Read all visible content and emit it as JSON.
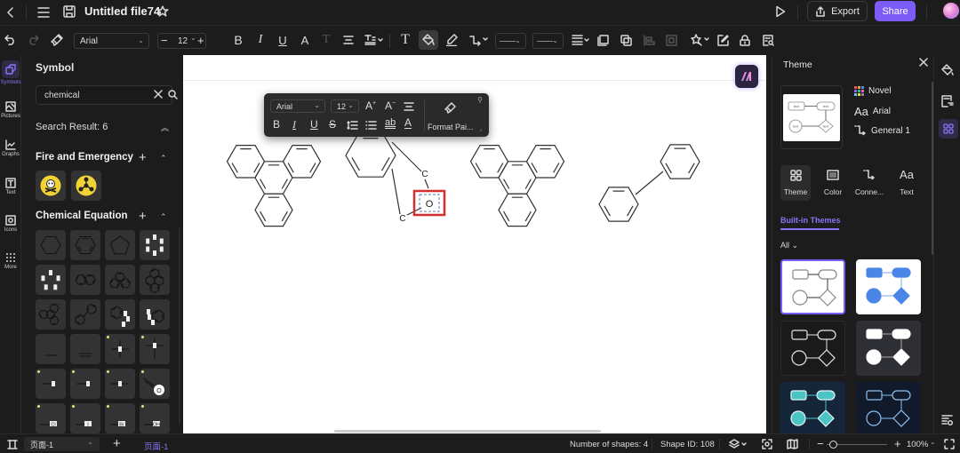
{
  "app": {
    "file_title": "Untitled file74",
    "export_label": "Export",
    "share_label": "Share"
  },
  "toolbar": {
    "font_family": "Arial",
    "font_size": "12"
  },
  "rail": {
    "items": [
      {
        "label": "Symbols",
        "icon": "symbols-icon",
        "active": true
      },
      {
        "label": "Pictures",
        "icon": "pictures-icon"
      },
      {
        "label": "Graphs",
        "icon": "graphs-icon"
      },
      {
        "label": "Text",
        "icon": "text-icon"
      },
      {
        "label": "Icons",
        "icon": "icons-icon"
      },
      {
        "label": "More",
        "icon": "more-icon"
      }
    ]
  },
  "symbol_panel": {
    "title": "Symbol",
    "search_value": "chemical",
    "search_result": "Search Result: 6",
    "categories": [
      {
        "name": "Fire and Emergency",
        "items": [
          "toxic-skull-symbol",
          "radiation-hazard-symbol"
        ]
      },
      {
        "name": "Chemical Equation",
        "items": [
          "cyclohexane",
          "benzene",
          "cyclopentane",
          "hexagon-atoms",
          "pentagon-atoms",
          "naphthalene",
          "phenanthrene",
          "pyrene",
          "triphenylene",
          "biphenyl",
          "indane",
          "indane-reversed",
          "single-bond",
          "double-bond",
          "carbon-cross",
          "carbon-cross-2",
          "bond-h",
          "bond-f",
          "bond-o",
          "bond-o-circle",
          "bond-cl",
          "bond-i",
          "bond-br",
          "bond-oh"
        ]
      }
    ],
    "atom_labels": {
      "cl": "Cl",
      "i": "I",
      "br": "Br",
      "oh": "OH",
      "o": "O"
    }
  },
  "format_toolbar": {
    "font_family": "Arial",
    "font_size": "12",
    "format_painter_label": "Format Pai..."
  },
  "canvas": {
    "shapes": [
      {
        "name": "triphenylene-1"
      },
      {
        "name": "indane-with-oxygen",
        "atoms": [
          "C",
          "C",
          "O"
        ]
      },
      {
        "name": "triphenylene-2"
      },
      {
        "name": "biphenyl"
      }
    ],
    "selected_atom": "O"
  },
  "theme_panel": {
    "title": "Theme",
    "preview_node_label": "text",
    "properties": [
      {
        "icon": "palette-icon",
        "label": "Novel"
      },
      {
        "icon": "font-icon",
        "label": "Arial"
      },
      {
        "icon": "connector-icon",
        "label": "General 1"
      }
    ],
    "font_glyph": "Aa",
    "tabs": [
      {
        "label": "Theme",
        "active": true
      },
      {
        "label": "Color"
      },
      {
        "label": "Conne..."
      },
      {
        "label": "Text"
      }
    ],
    "section_title": "Built-in Themes",
    "filter": "All",
    "themes": [
      {
        "style": "outline-light",
        "selected": true
      },
      {
        "style": "blue-filled-light"
      },
      {
        "style": "outline-dark"
      },
      {
        "style": "white-filled-dark"
      },
      {
        "style": "teal-filled-navy"
      },
      {
        "style": "blue-outline-navy"
      }
    ]
  },
  "status_bar": {
    "page_select": "页面-1",
    "page_tab": "页面-1",
    "shape_count": "Number of shapes: 4",
    "shape_id": "Shape ID: 108",
    "zoom_level": "100%"
  }
}
